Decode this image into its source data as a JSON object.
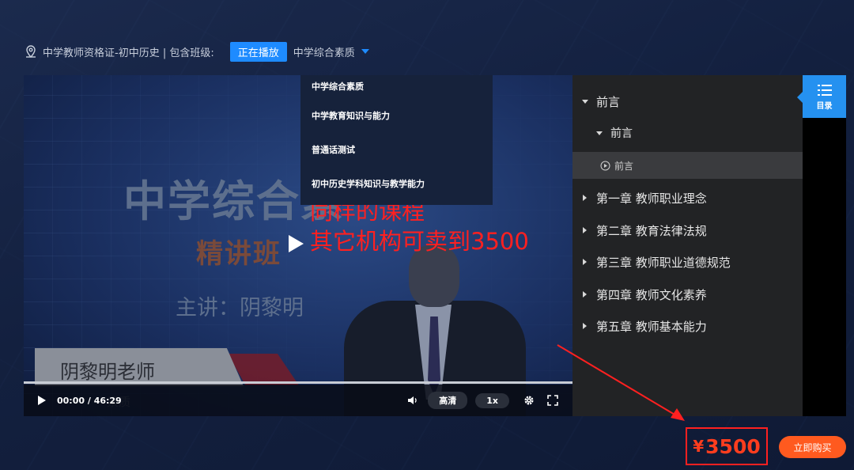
{
  "header": {
    "course_title": "中学教师资格证-初中历史 | 包含班级:",
    "playing_badge": "正在播放",
    "selected_class": "中学综合素质",
    "icon": "location-pin-icon"
  },
  "dropdown": {
    "options": [
      "中学综合素质",
      "中学教育知识与能力",
      "普通话测试",
      "初中历史学科知识与教学能力"
    ]
  },
  "video": {
    "slide_title": "中学综合素",
    "slide_subtitle": "精讲班",
    "slide_lecturer": "主讲：阴黎明",
    "name_plate": "阴黎明老师",
    "ghost_text": "素质",
    "overlay_note_line1": "同样的课程",
    "overlay_note_line2": "其它机构可卖到3500",
    "time": "00:00 / 46:29",
    "quality": "高清",
    "speed": "1x",
    "progress": 0
  },
  "sidebar": {
    "items": [
      {
        "label": "前言",
        "level": "chapter",
        "expanded": true
      },
      {
        "label": "前言",
        "level": "section",
        "expanded": true
      },
      {
        "label": "前言",
        "level": "lesson",
        "active": true
      },
      {
        "label": "第一章 教师职业理念",
        "level": "chapter"
      },
      {
        "label": "第二章 教育法律法规",
        "level": "chapter"
      },
      {
        "label": "第三章 教师职业道德规范",
        "level": "chapter"
      },
      {
        "label": "第四章 教师文化素养",
        "level": "chapter"
      },
      {
        "label": "第五章 教师基本能力",
        "level": "chapter"
      }
    ],
    "catalog_label": "目录"
  },
  "purchase": {
    "currency": "¥",
    "price": "3500",
    "buy_label": "立即购买"
  },
  "colors": {
    "accent_blue": "#1e8bff",
    "price_red": "#ff3d1e",
    "buy_orange": "#ff5a1f",
    "annotation_red": "#ff2020"
  }
}
